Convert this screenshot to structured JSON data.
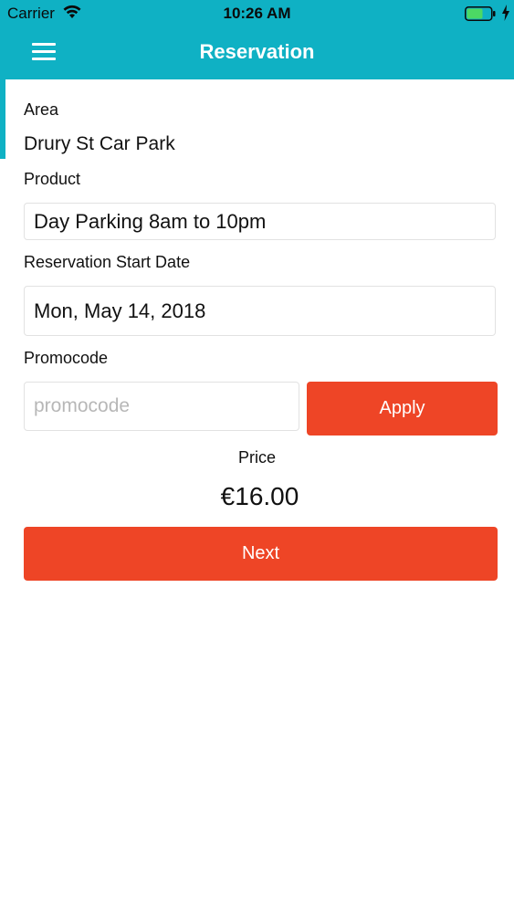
{
  "status_bar": {
    "carrier": "Carrier",
    "time": "10:26 AM"
  },
  "nav": {
    "title": "Reservation",
    "menu_icon": "hamburger-icon"
  },
  "form": {
    "area_label": "Area",
    "area_value": "Drury St Car Park",
    "product_label": "Product",
    "product_value": "Day Parking 8am to 10pm",
    "start_date_label": "Reservation Start Date",
    "start_date_value": "Mon, May 14, 2018",
    "promocode_label": "Promocode",
    "promocode_value": "",
    "promocode_placeholder": "promocode",
    "apply_label": "Apply",
    "price_label": "Price",
    "price_value": "€16.00",
    "next_label": "Next"
  },
  "colors": {
    "header": "#0fb1c4",
    "button": "#ee4526"
  }
}
